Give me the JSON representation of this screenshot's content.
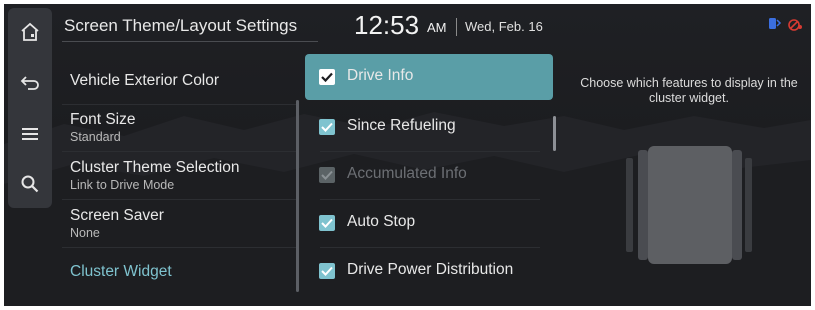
{
  "header": {
    "title": "Screen Theme/Layout Settings",
    "time": "12:53",
    "ampm": "AM",
    "date": "Wed, Feb. 16",
    "status_icons": [
      "bluetooth-phone-icon",
      "no-signal-icon"
    ]
  },
  "siderail": {
    "buttons": [
      {
        "name": "home-icon"
      },
      {
        "name": "back-icon"
      },
      {
        "name": "menu-icon"
      },
      {
        "name": "search-icon"
      }
    ]
  },
  "menu": {
    "items": [
      {
        "label": "Vehicle Exterior Color",
        "sub": ""
      },
      {
        "label": "Font Size",
        "sub": "Standard"
      },
      {
        "label": "Cluster Theme Selection",
        "sub": "Link to Drive Mode"
      },
      {
        "label": "Screen Saver",
        "sub": "None"
      },
      {
        "label": "Cluster Widget",
        "sub": "",
        "selected": true
      }
    ]
  },
  "options": [
    {
      "label": "Drive Info",
      "checked": true,
      "active": true,
      "disabled": false
    },
    {
      "label": "Since Refueling",
      "checked": true,
      "active": false,
      "disabled": false
    },
    {
      "label": "Accumulated Info",
      "checked": true,
      "active": false,
      "disabled": true
    },
    {
      "label": "Auto Stop",
      "checked": true,
      "active": false,
      "disabled": false
    },
    {
      "label": "Drive Power Distribution",
      "checked": true,
      "active": false,
      "disabled": false
    }
  ],
  "description": "Choose which features to display in the cluster widget.",
  "colors": {
    "accent": "#5a9ea7",
    "checkbox": "#7fc3cf",
    "selected_menu_text": "#7fc3cf",
    "background": "#1c1d20",
    "bluetooth_icon": "#3b6fe0",
    "warning_icon": "#d63a32"
  }
}
